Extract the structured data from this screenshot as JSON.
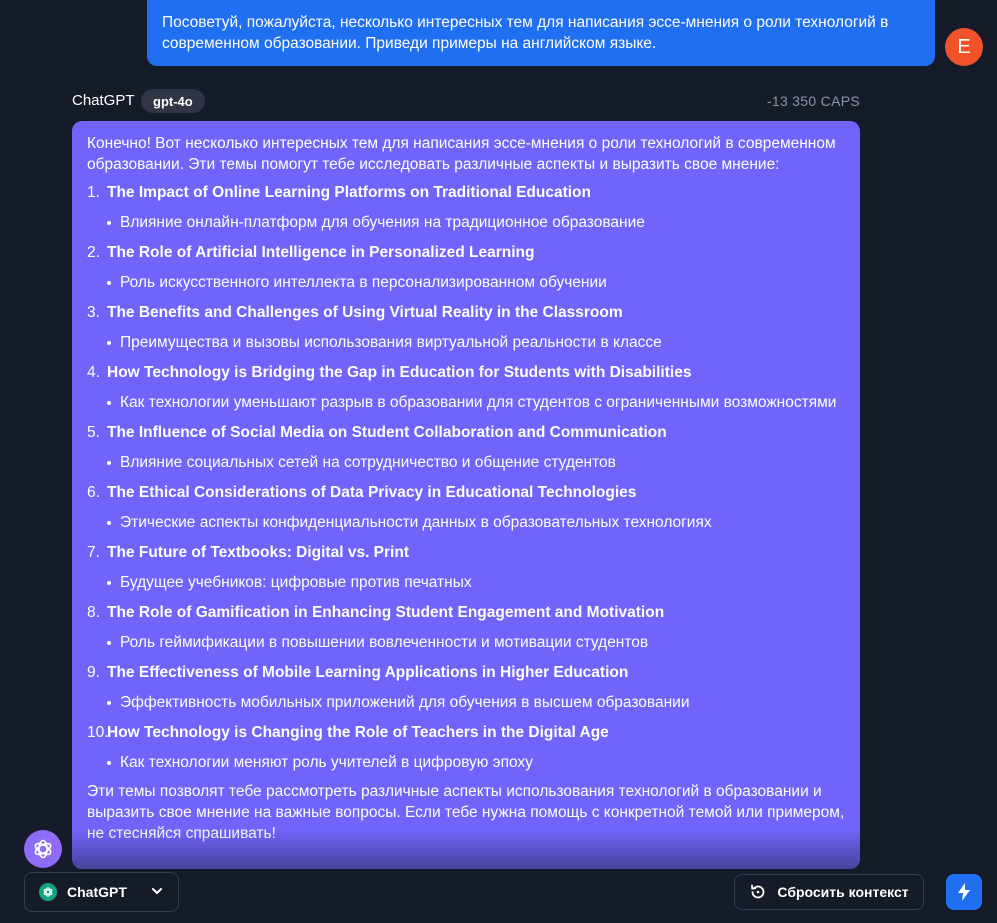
{
  "user": {
    "message": "Посоветуй, пожалуйста, несколько интересных тем для написания эссе-мнения о роли технологий в современном образовании. Приведи примеры на английском языке.",
    "avatar_letter": "E"
  },
  "assistant": {
    "name": "ChatGPT",
    "model": "gpt-4o",
    "caps": "-13 350 CAPS",
    "intro": "Конечно! Вот несколько интересных тем для написания эссе-мнения о роли технологий в современном образовании. Эти темы помогут тебе исследовать различные аспекты и выразить свое мнение:",
    "topics": [
      {
        "num": "1.",
        "title": "The Impact of Online Learning Platforms on Traditional Education",
        "sub": "Влияние онлайн-платформ для обучения на традиционное образование"
      },
      {
        "num": "2.",
        "title": "The Role of Artificial Intelligence in Personalized Learning",
        "sub": "Роль искусственного интеллекта в персонализированном обучении"
      },
      {
        "num": "3.",
        "title": "The Benefits and Challenges of Using Virtual Reality in the Classroom",
        "sub": "Преимущества и вызовы использования виртуальной реальности в классе"
      },
      {
        "num": "4.",
        "title": "How Technology is Bridging the Gap in Education for Students with Disabilities",
        "sub": "Как технологии уменьшают разрыв в образовании для студентов с ограниченными возможностями"
      },
      {
        "num": "5.",
        "title": "The Influence of Social Media on Student Collaboration and Communication",
        "sub": "Влияние социальных сетей на сотрудничество и общение студентов"
      },
      {
        "num": "6.",
        "title": "The Ethical Considerations of Data Privacy in Educational Technologies",
        "sub": "Этические аспекты конфиденциальности данных в образовательных технологиях"
      },
      {
        "num": "7.",
        "title": "The Future of Textbooks: Digital vs. Print",
        "sub": "Будущее учебников: цифровые против печатных"
      },
      {
        "num": "8.",
        "title": "The Role of Gamification in Enhancing Student Engagement and Motivation",
        "sub": "Роль геймификации в повышении вовлеченности и мотивации студентов"
      },
      {
        "num": "9.",
        "title": "The Effectiveness of Mobile Learning Applications in Higher Education",
        "sub": "Эффективность мобильных приложений для обучения в высшем образовании"
      },
      {
        "num": "10.",
        "title": "How Technology is Changing the Role of Teachers in the Digital Age",
        "sub": "Как технологии меняют роль учителей в цифровую эпоху"
      }
    ],
    "outro": "Эти темы позволят тебе рассмотреть различные аспекты использования технологий в образовании и выразить свое мнение на важные вопросы. Если тебе нужна помощь с конкретной темой или примером, не стесняйся спрашивать!"
  },
  "footer": {
    "model_select_label": "ChatGPT",
    "reset_label": "Сбросить контекст"
  },
  "icons": {
    "gpt_avatar": "openai-icon",
    "chevron": "chevron-down-icon",
    "reset": "reset-icon",
    "bolt": "bolt-icon"
  },
  "colors": {
    "background": "#161b2a",
    "user_bubble": "#1f6ff0",
    "assistant_bubble": "#7164fa",
    "user_avatar": "#f0532a"
  }
}
